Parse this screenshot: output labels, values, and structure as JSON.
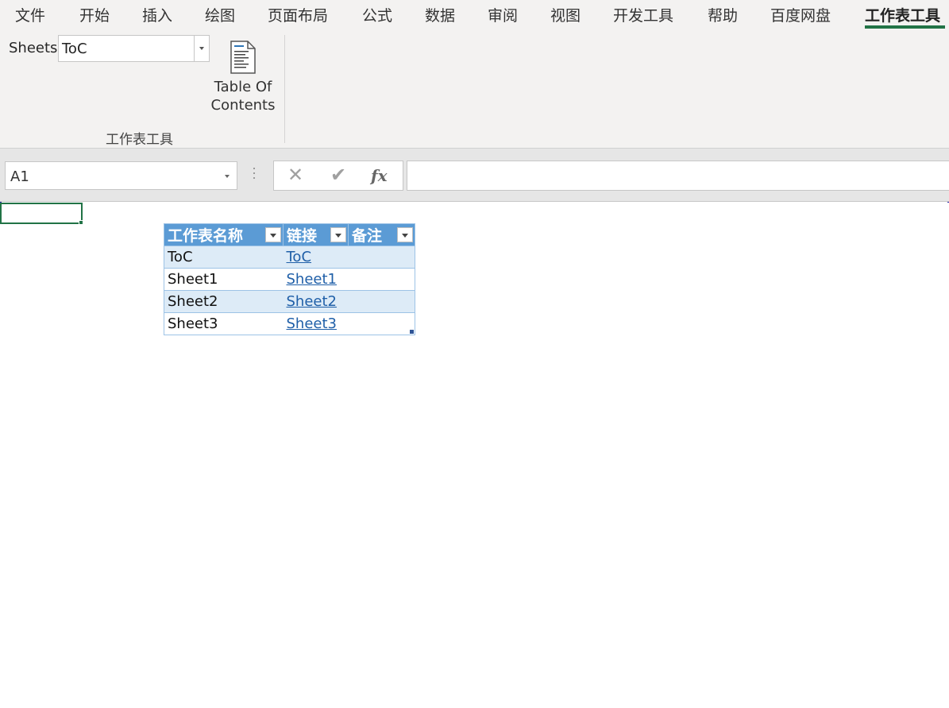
{
  "ribbon": {
    "tabs": [
      "文件",
      "开始",
      "插入",
      "绘图",
      "页面布局",
      "公式",
      "数据",
      "审阅",
      "视图",
      "开发工具",
      "帮助",
      "百度网盘",
      "工作表工具"
    ],
    "active_tab": "工作表工具",
    "sheets_label": "Sheets",
    "sheets_value": "ToC",
    "toc_button_line1": "Table Of",
    "toc_button_line2": "Contents",
    "group_label": "工作表工具"
  },
  "formula_bar": {
    "name_box": "A1",
    "cancel_icon": "✕",
    "enter_icon": "✔",
    "fx_label": "fx",
    "formula": ""
  },
  "table": {
    "headers": [
      "工作表名称",
      "链接",
      "备注"
    ],
    "rows": [
      {
        "name": "ToC",
        "link": "ToC",
        "note": ""
      },
      {
        "name": "Sheet1",
        "link": "Sheet1",
        "note": ""
      },
      {
        "name": "Sheet2",
        "link": "Sheet2",
        "note": ""
      },
      {
        "name": "Sheet3",
        "link": "Sheet3",
        "note": ""
      }
    ]
  },
  "colors": {
    "accent": "#217346",
    "table_header": "#5b9bd5",
    "table_band": "#ddebf7",
    "link": "#1f5fa8"
  }
}
